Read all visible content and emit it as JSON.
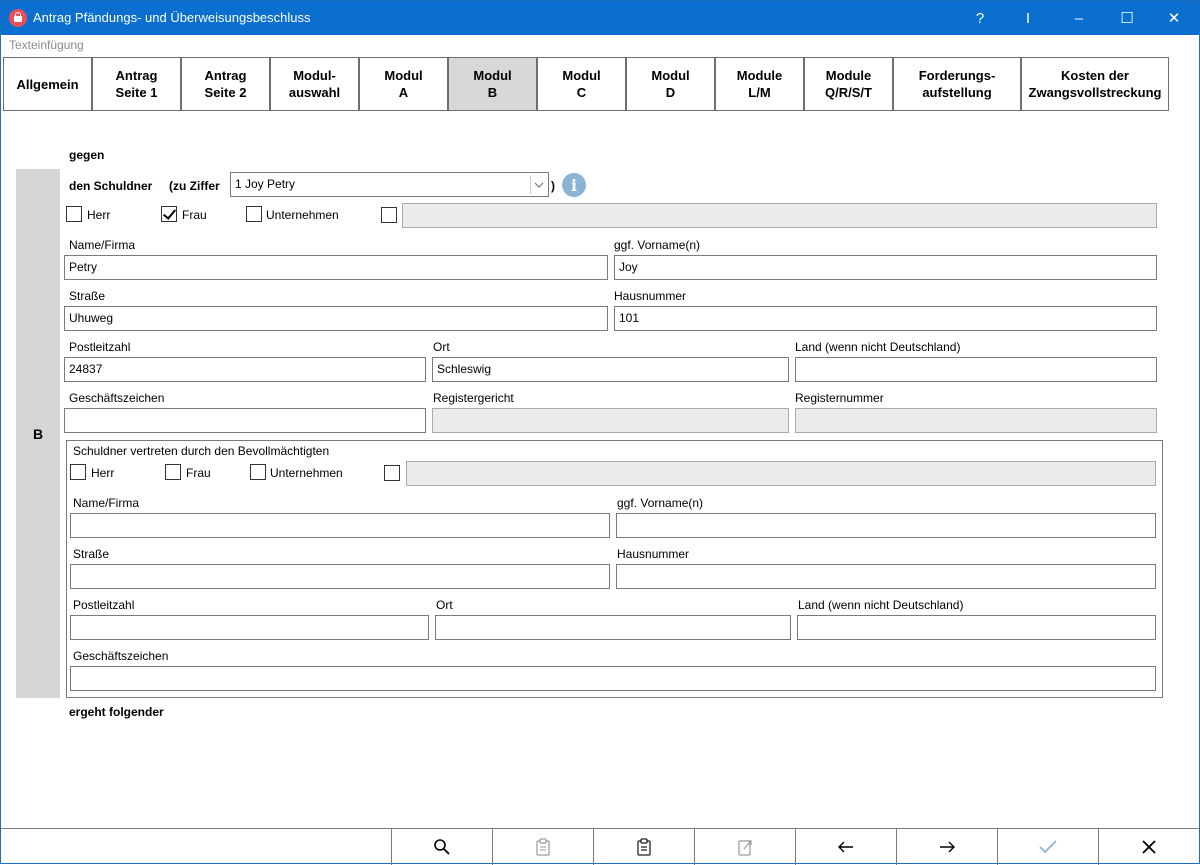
{
  "window": {
    "title": "Antrag Pfändungs- und Überweisungsbeschluss",
    "controls": {
      "help": "?",
      "pin": "I",
      "minimize": "–",
      "maximize": "☐",
      "close": "✕"
    }
  },
  "menu": {
    "texteinfuegung": "Texteinfügung"
  },
  "tabs": [
    {
      "label": "Allgemein"
    },
    {
      "label": "Antrag\nSeite 1"
    },
    {
      "label": "Antrag\nSeite 2"
    },
    {
      "label": "Modul-\nauswahl"
    },
    {
      "label": "Modul\nA"
    },
    {
      "label": "Modul\nB",
      "active": true
    },
    {
      "label": "Modul\nC"
    },
    {
      "label": "Modul\nD"
    },
    {
      "label": "Module\nL/M"
    },
    {
      "label": "Module\nQ/R/S/T"
    },
    {
      "label": "Forderungs-\naufstellung"
    },
    {
      "label": "Kosten der\nZwangsvollstreckung"
    }
  ],
  "section": {
    "side_label": "B",
    "gegen": "gegen",
    "schuldner_label": "den Schuldner",
    "zu_ziffer": "(zu Ziffer",
    "ziffer_value": "1  Joy Petry",
    "close_paren": ")",
    "ergeht": "ergeht folgender"
  },
  "schuldner": {
    "salutation": {
      "herr": "Herr",
      "frau": "Frau",
      "unternehmen": "Unternehmen",
      "herr_checked": false,
      "frau_checked": true,
      "unternehmen_checked": false,
      "other_checked": false,
      "other_value": ""
    },
    "labels": {
      "name": "Name/Firma",
      "vorname": "ggf. Vorname(n)",
      "strasse": "Straße",
      "hausnummer": "Hausnummer",
      "plz": "Postleitzahl",
      "ort": "Ort",
      "land": "Land (wenn nicht Deutschland)",
      "geschaeftszeichen": "Geschäftszeichen",
      "registergericht": "Registergericht",
      "registernummer": "Registernummer"
    },
    "values": {
      "name": "Petry",
      "vorname": "Joy",
      "strasse": "Uhuweg",
      "hausnummer": "101",
      "plz": "24837",
      "ort": "Schleswig",
      "land": "",
      "geschaeftszeichen": "",
      "registergericht": "",
      "registernummer": ""
    }
  },
  "bevollmaechtigter": {
    "title": "Schuldner vertreten durch den Bevollmächtigten",
    "salutation": {
      "herr": "Herr",
      "frau": "Frau",
      "unternehmen": "Unternehmen",
      "herr_checked": false,
      "frau_checked": false,
      "unternehmen_checked": false,
      "other_checked": false,
      "other_value": ""
    },
    "labels": {
      "name": "Name/Firma",
      "vorname": "ggf. Vorname(n)",
      "strasse": "Straße",
      "hausnummer": "Hausnummer",
      "plz": "Postleitzahl",
      "ort": "Ort",
      "land": "Land (wenn nicht Deutschland)",
      "geschaeftszeichen": "Geschäftszeichen"
    },
    "values": {
      "name": "",
      "vorname": "",
      "strasse": "",
      "hausnummer": "",
      "plz": "",
      "ort": "",
      "land": "",
      "geschaeftszeichen": ""
    }
  },
  "toolbar": [
    {
      "icon": "search-icon"
    },
    {
      "icon": "clipboard-disabled-icon"
    },
    {
      "icon": "clipboard-icon"
    },
    {
      "icon": "export-disabled-icon"
    },
    {
      "icon": "arrow-left-icon"
    },
    {
      "icon": "arrow-right-icon"
    },
    {
      "icon": "check-icon"
    },
    {
      "icon": "close-icon"
    }
  ],
  "colors": {
    "titlebar": "#0a6fcf",
    "active_tab": "#d8d8d8",
    "side_tab": "#d6d6d6",
    "disabled_field": "#ebebeb"
  }
}
